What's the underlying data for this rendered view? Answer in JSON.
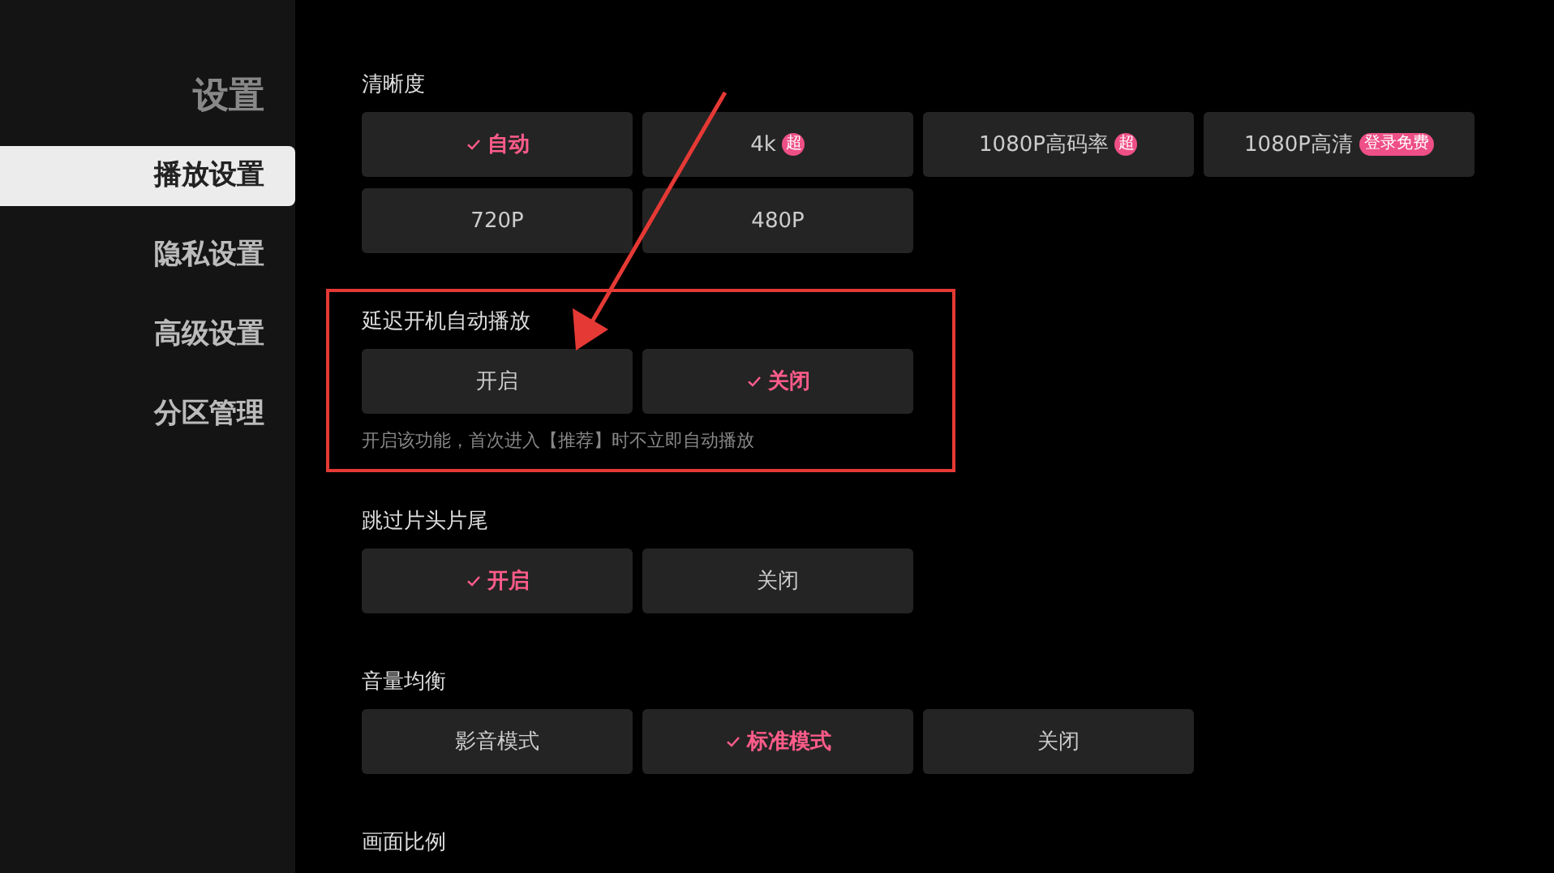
{
  "sidebar": {
    "title": "设置",
    "items": [
      {
        "label": "播放设置",
        "selected": true
      },
      {
        "label": "隐私设置",
        "selected": false
      },
      {
        "label": "高级设置",
        "selected": false
      },
      {
        "label": "分区管理",
        "selected": false
      }
    ]
  },
  "sections": [
    {
      "title": "清晰度",
      "highlighted": false,
      "options": [
        {
          "label": "自动",
          "selected": true
        },
        {
          "label": "4k",
          "selected": false,
          "badge": {
            "kind": "round",
            "text": "超"
          }
        },
        {
          "label": "1080P高码率",
          "selected": false,
          "badge": {
            "kind": "round",
            "text": "超"
          }
        },
        {
          "label": "1080P高清",
          "selected": false,
          "badge": {
            "kind": "pill",
            "text": "登录免费"
          }
        },
        {
          "label": "720P",
          "selected": false
        },
        {
          "label": "480P",
          "selected": false
        }
      ]
    },
    {
      "title": "延迟开机自动播放",
      "highlighted": true,
      "hint": "开启该功能，首次进入【推荐】时不立即自动播放",
      "options": [
        {
          "label": "开启",
          "selected": false
        },
        {
          "label": "关闭",
          "selected": true
        }
      ]
    },
    {
      "title": "跳过片头片尾",
      "highlighted": false,
      "options": [
        {
          "label": "开启",
          "selected": true
        },
        {
          "label": "关闭",
          "selected": false
        }
      ]
    },
    {
      "title": "音量均衡",
      "highlighted": false,
      "options": [
        {
          "label": "影音模式",
          "selected": false
        },
        {
          "label": "标准模式",
          "selected": true
        },
        {
          "label": "关闭",
          "selected": false
        }
      ]
    },
    {
      "title": "画面比例",
      "highlighted": false
    }
  ]
}
